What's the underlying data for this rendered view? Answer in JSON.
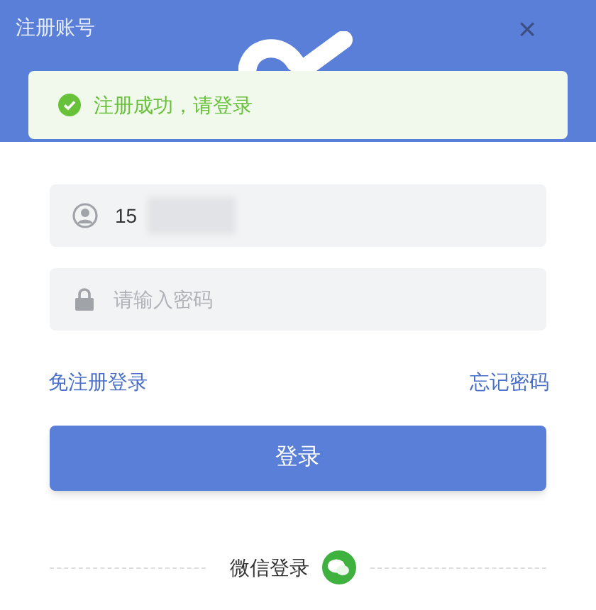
{
  "window": {
    "title": "注册账号",
    "close": "×"
  },
  "toast": {
    "kind": "success",
    "message": "注册成功，请登录"
  },
  "username": {
    "value": "15"
  },
  "password": {
    "placeholder": "请输入密码"
  },
  "links": [
    "免注册登录",
    "忘记密码"
  ],
  "login_button": "登录",
  "alt_login": {
    "label": "微信登录"
  }
}
